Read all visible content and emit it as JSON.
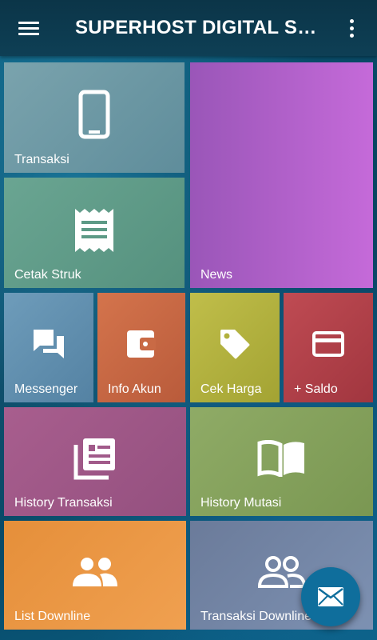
{
  "app": {
    "title": "SUPERHOST DIGITAL SY...",
    "menu_icon": "hamburger-menu-icon",
    "more_icon": "more-vertical-icon"
  },
  "tiles": {
    "transaksi": {
      "label": "Transaksi",
      "icon": "phone-icon",
      "color": "#6d97a3"
    },
    "news": {
      "label": "News",
      "icon": "",
      "color": "#b05ec7"
    },
    "cetak_struk": {
      "label": "Cetak Struk",
      "icon": "receipt-icon",
      "color": "#5d9a86"
    },
    "messenger": {
      "label": "Messenger",
      "icon": "chat-icon",
      "color": "#5f8fae"
    },
    "info_akun": {
      "label": "Info Akun",
      "icon": "wallet-icon",
      "color": "#c96a45"
    },
    "cek_harga": {
      "label": "Cek Harga",
      "icon": "price-tag-icon",
      "color": "#b2b13e"
    },
    "saldo": {
      "label": "+ Saldo",
      "icon": "credit-card-icon",
      "color": "#b3424a"
    },
    "history_transaksi": {
      "label": "History Transaksi",
      "icon": "document-list-icon",
      "color": "#a15a8a"
    },
    "history_mutasi": {
      "label": "History Mutasi",
      "icon": "open-book-icon",
      "color": "#87a35f"
    },
    "list_downline": {
      "label": "List Downline",
      "icon": "group-icon",
      "color": "#e5913e"
    },
    "transaksi_downline": {
      "label": "Transaksi Downline",
      "icon": "group-outline-icon",
      "color": "#6c7ea0"
    }
  },
  "fab": {
    "icon": "mail-icon",
    "color": "#0f6e9c"
  }
}
